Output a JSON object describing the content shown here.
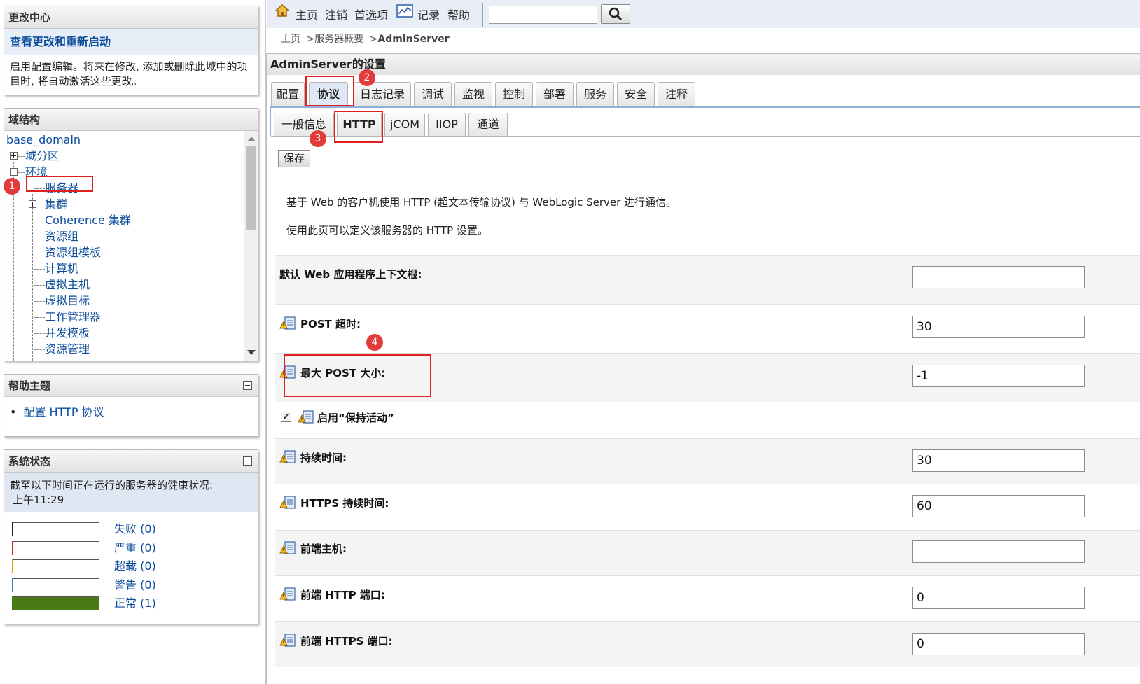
{
  "change_center": {
    "title": "更改中心",
    "link": "查看更改和重新启动",
    "description": "启用配置编辑。将来在修改, 添加或删除此域中的项目时, 将自动激活这些更改。"
  },
  "domain_structure": {
    "title": "域结构",
    "root": "base_domain",
    "items": [
      "域分区",
      "环境",
      "服务器",
      "集群",
      "Coherence 集群",
      "资源组",
      "资源组模板",
      "计算机",
      "虚拟主机",
      "虚拟目标",
      "工作管理器",
      "并发模板",
      "资源管理"
    ]
  },
  "help_topics": {
    "title": "帮助主题",
    "items": [
      "配置 HTTP 协议"
    ]
  },
  "system_status": {
    "title": "系统状态",
    "description": "截至以下时间正在运行的服务器的健康状况:",
    "time": "上午11:29",
    "rows": [
      {
        "label": "失败 (0)",
        "color": "#222222",
        "fill": 0
      },
      {
        "label": "严重 (0)",
        "color": "#cc2222",
        "fill": 0
      },
      {
        "label": "超载 (0)",
        "color": "#d8a000",
        "fill": 0
      },
      {
        "label": "警告 (0)",
        "color": "#3a7fc0",
        "fill": 0
      },
      {
        "label": "正常 (1)",
        "color": "#4a7a18",
        "fill": 1
      }
    ]
  },
  "topbar": {
    "home": "主页",
    "logout": "注销",
    "preferences": "首选项",
    "record": "记录",
    "help": "帮助",
    "search_value": ""
  },
  "breadcrumb": {
    "home": "主页",
    "sep": ">",
    "servers": "服务器概要",
    "current": "AdminServer"
  },
  "settings": {
    "title": "AdminServer的设置",
    "tabs": [
      "配置",
      "协议",
      "日志记录",
      "调试",
      "监视",
      "控制",
      "部署",
      "服务",
      "安全",
      "注释"
    ],
    "active_tab": "协议",
    "subtabs": [
      "一般信息",
      "HTTP",
      "jCOM",
      "IIOP",
      "通道"
    ],
    "active_subtab": "HTTP",
    "save_label": "保存",
    "intro_1": "基于 Web 的客户机使用 HTTP (超文本传输协议) 与 WebLogic Server 进行通信。",
    "intro_2": "使用此页可以定义该服务器的 HTTP 设置。",
    "fields": {
      "default_context_root": {
        "label": "默认 Web 应用程序上下文根:",
        "value": ""
      },
      "post_timeout": {
        "label": "POST 超时:",
        "value": "30"
      },
      "max_post_size": {
        "label": "最大 POST 大小:",
        "value": "-1"
      },
      "keep_alive": {
        "label": "启用“保持活动”",
        "checked": true
      },
      "duration": {
        "label": "持续时间:",
        "value": "30"
      },
      "https_duration": {
        "label": "HTTPS 持续时间:",
        "value": "60"
      },
      "frontend_host": {
        "label": "前端主机:",
        "value": ""
      },
      "frontend_http_port": {
        "label": "前端 HTTP 端口:",
        "value": "0"
      },
      "frontend_https_port": {
        "label": "前端 HTTPS 端口:",
        "value": "0"
      }
    }
  },
  "annotations": [
    "1",
    "2",
    "3",
    "4"
  ],
  "colors": {
    "accent_red": "#e02020",
    "link_blue": "#0b4d9c",
    "topbar_bg": "#e9eef6"
  }
}
